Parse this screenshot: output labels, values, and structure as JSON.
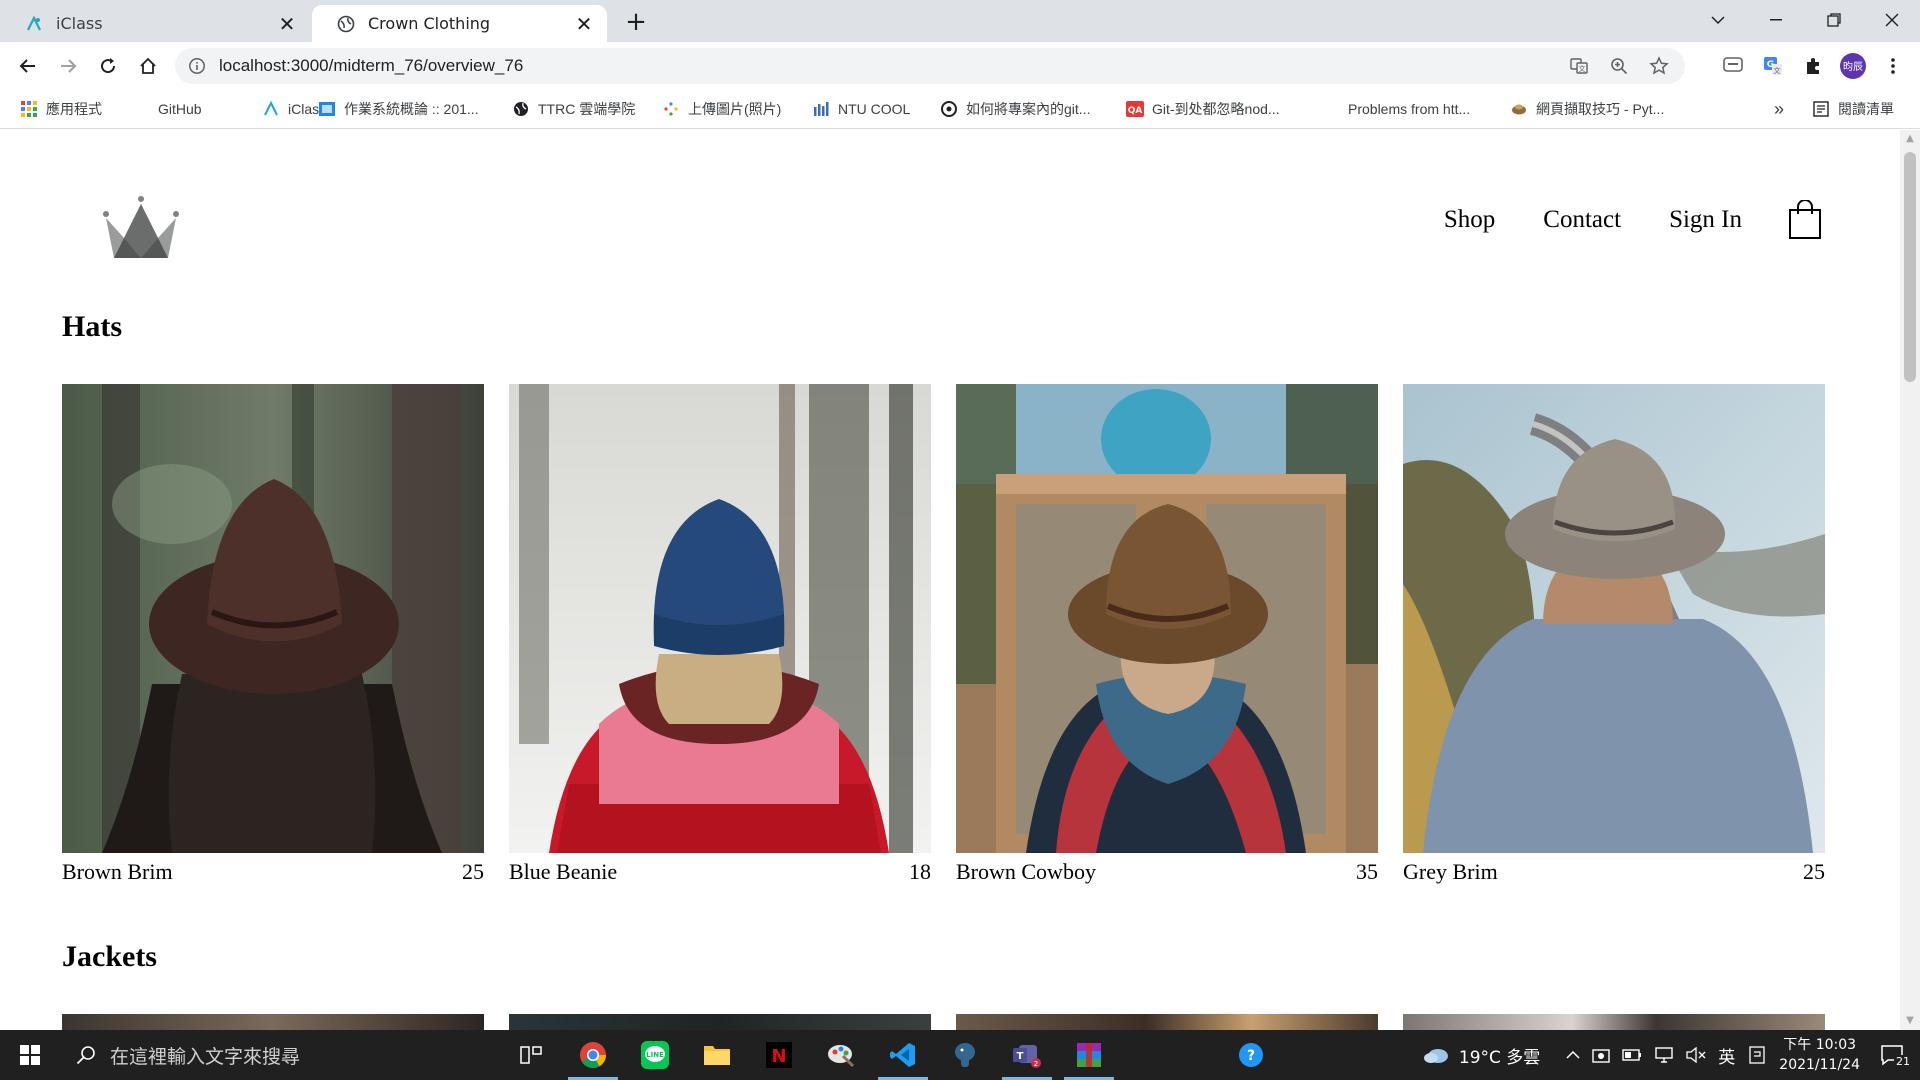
{
  "browser": {
    "tabs": [
      {
        "title": "iClass",
        "active": false
      },
      {
        "title": "Crown Clothing",
        "active": true
      }
    ],
    "url": "localhost:3000/midterm_76/overview_76",
    "bookmarks": [
      {
        "label": "應用程式",
        "icon": "apps-grid-icon"
      },
      {
        "label": "GitHub",
        "icon": "github-icon"
      },
      {
        "label": "iClass",
        "icon": "iclass-icon"
      },
      {
        "label": "作業系統概論 :: 201...",
        "icon": "course-icon"
      },
      {
        "label": "TTRC 雲端學院",
        "icon": "globe-icon"
      },
      {
        "label": "上傳圖片(照片)",
        "icon": "upload-icon"
      },
      {
        "label": "NTU COOL",
        "icon": "ntucool-icon"
      },
      {
        "label": "如何將專案內的git...",
        "icon": "web-icon"
      },
      {
        "label": "Git-到处都忽略nod...",
        "icon": "qa-icon"
      },
      {
        "label": "Problems from htt...",
        "icon": "blank-icon"
      },
      {
        "label": "網頁擷取技巧 - Pyt...",
        "icon": "bird-icon"
      }
    ],
    "more_bookmarks": "»",
    "reading_list": "閱讀清單"
  },
  "site": {
    "nav": {
      "shop": "Shop",
      "contact": "Contact",
      "signin": "Sign In"
    },
    "sections": [
      {
        "title": "Hats",
        "items": [
          {
            "name": "Brown Brim",
            "price": "25"
          },
          {
            "name": "Blue Beanie",
            "price": "18"
          },
          {
            "name": "Brown Cowboy",
            "price": "35"
          },
          {
            "name": "Grey Brim",
            "price": "25"
          }
        ]
      },
      {
        "title": "Jackets"
      }
    ]
  },
  "taskbar": {
    "search_placeholder": "在這裡輸入文字來搜尋",
    "weather": "19°C 多雲",
    "ime": "英",
    "time": "下午 10:03",
    "date": "2021/11/24",
    "notifications": "21"
  },
  "colors": {
    "tab_strip": "#dee1e6",
    "taskbar": "#202020",
    "beanie_blue": "#25497a",
    "jacket_red": "#c8192b"
  }
}
